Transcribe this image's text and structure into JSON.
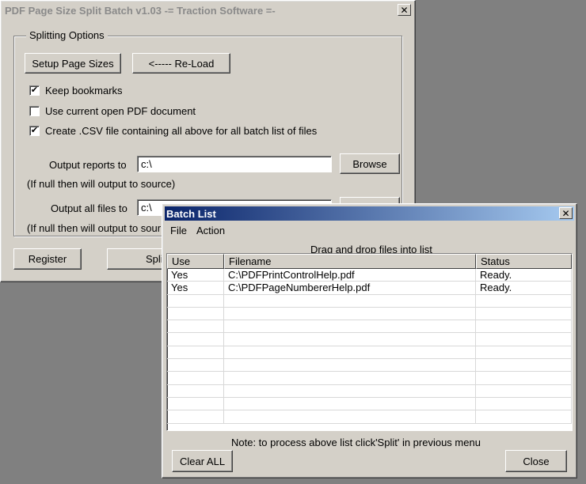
{
  "main_window": {
    "title": "PDF Page Size Split Batch v1.03  -= Traction Software =-",
    "close_glyph": "✕",
    "group_label": "Splitting Options",
    "setup_button": "Setup Page Sizes",
    "reload_button": "<----- Re-Load",
    "checkboxes": [
      {
        "label": "Keep bookmarks",
        "checked": true
      },
      {
        "label": "Use current open PDF document",
        "checked": false
      },
      {
        "label": "Create .CSV file containing all above for all batch list of files",
        "checked": true
      }
    ],
    "output_reports": {
      "label": "Output reports to",
      "value": "c:\\",
      "browse": "Browse",
      "note": "(If null then will output to source)"
    },
    "output_files": {
      "label": "Output all files to",
      "value": "c:\\",
      "note": "(If null then will output to sour"
    },
    "register_button": "Register",
    "split_button": "Spli"
  },
  "batch_window": {
    "title": "Batch List",
    "close_glyph": "✕",
    "menu": [
      "File",
      "Action"
    ],
    "hint": "Drag and drop files into list",
    "columns": [
      "Use",
      "Filename",
      "Status"
    ],
    "rows": [
      {
        "use": "Yes",
        "filename": "C:\\PDFPrintControlHelp.pdf",
        "status": "Ready."
      },
      {
        "use": "Yes",
        "filename": "C:\\PDFPageNumbererHelp.pdf",
        "status": "Ready."
      }
    ],
    "note": "Note: to process above list click'Split' in previous menu",
    "clear_button": "Clear ALL",
    "close_button": "Close"
  },
  "colors": {
    "desktop": "#808080",
    "face": "#d4d0c8",
    "active_title_start": "#0a246a",
    "active_title_end": "#a6caf0"
  },
  "icons": {
    "close": "close-icon",
    "check": "checkmark-icon"
  }
}
